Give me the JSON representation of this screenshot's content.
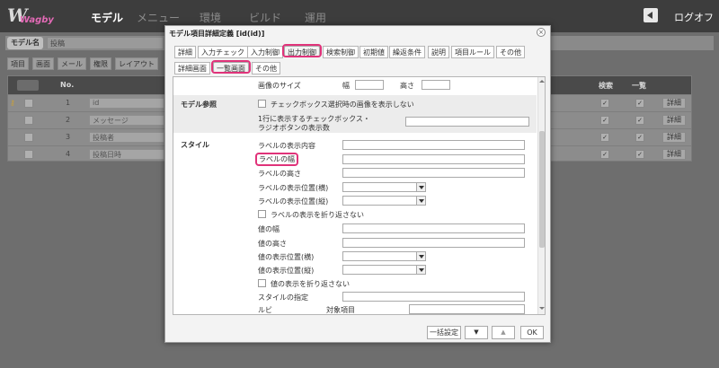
{
  "brand": {
    "logo_main": "W",
    "logo_sub": "Wagby"
  },
  "topnav": [
    "モデル",
    "メニュー",
    "環境",
    "ビルド",
    "運用"
  ],
  "logout_label": "ログオフ",
  "model": {
    "label": "モデル名",
    "value": "投稿"
  },
  "bg_tabs": [
    "項目",
    "画面",
    "メール",
    "権限",
    "レイアウト"
  ],
  "bg_table": {
    "headers": [
      "No.",
      "検索",
      "一覧"
    ],
    "rows": [
      {
        "no": "1",
        "id": "id",
        "detail": "詳細"
      },
      {
        "no": "2",
        "id": "メッセージ",
        "detail": "詳細"
      },
      {
        "no": "3",
        "id": "投稿者",
        "detail": "詳細"
      },
      {
        "no": "4",
        "id": "投稿日時",
        "detail": "詳細"
      }
    ]
  },
  "dialog": {
    "title": "モデル項目詳細定義 [id(id)]",
    "tabs_row1": [
      "詳細",
      "入力チェック",
      "入力制御",
      "出力制御",
      "検索制御",
      "初期値",
      "繰返条件",
      "説明",
      "項目ルール",
      "その他"
    ],
    "tabs_row2": [
      "詳細画面",
      "一覧画面",
      "その他"
    ],
    "image_size": {
      "label": "画像のサイズ",
      "width_label": "幅",
      "height_label": "高さ"
    },
    "model_ref": {
      "label": "モデル参照",
      "hide_image": "チェックボックス選択時の画像を表示しない",
      "count_label_1": "1行に表示するチェックボックス・",
      "count_label_2": "ラジオボタンの表示数"
    },
    "style": {
      "label": "スタイル",
      "rows": [
        "ラベルの表示内容",
        "ラベルの幅",
        "ラベルの高さ",
        "ラベルの表示位置(横)",
        "ラベルの表示位置(縦)",
        "ラベルの表示を折り返さない",
        "値の幅",
        "値の高さ",
        "値の表示位置(横)",
        "値の表示位置(縦)",
        "値の表示を折り返さない",
        "スタイルの指定",
        "ルビ"
      ],
      "ruby_target": "対象項目"
    },
    "footer": {
      "bulk": "一括設定",
      "down": "▼",
      "up": "▲",
      "ok": "OK"
    }
  }
}
